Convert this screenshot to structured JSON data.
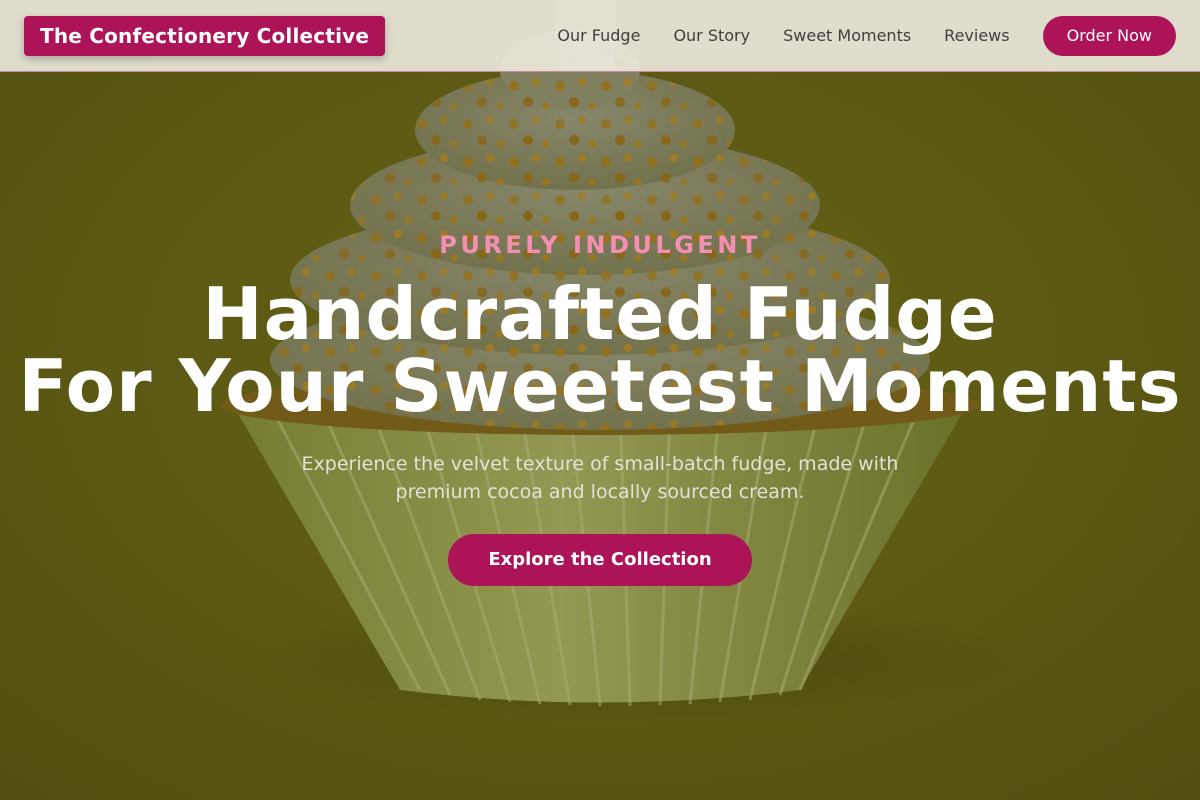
{
  "colors": {
    "accent": "#ad1457",
    "eyebrow": "#f48fb1",
    "hero_bg": "#6b6a1f",
    "nav_bg": "#ece8dc"
  },
  "hero_image": {
    "icon": "cupcake-photo"
  },
  "navbar": {
    "brand": "The Confectionery Collective",
    "links": [
      "Our Fudge",
      "Our Story",
      "Sweet Moments",
      "Reviews"
    ],
    "cta_label": "Order Now"
  },
  "hero": {
    "eyebrow": "PURELY INDULGENT",
    "headline_line1": "Handcrafted Fudge",
    "headline_line2": "For Your Sweetest Moments",
    "subtext": "Experience the velvet texture of small-batch fudge, made with premium cocoa and locally sourced cream.",
    "cta_label": "Explore the Collection"
  }
}
